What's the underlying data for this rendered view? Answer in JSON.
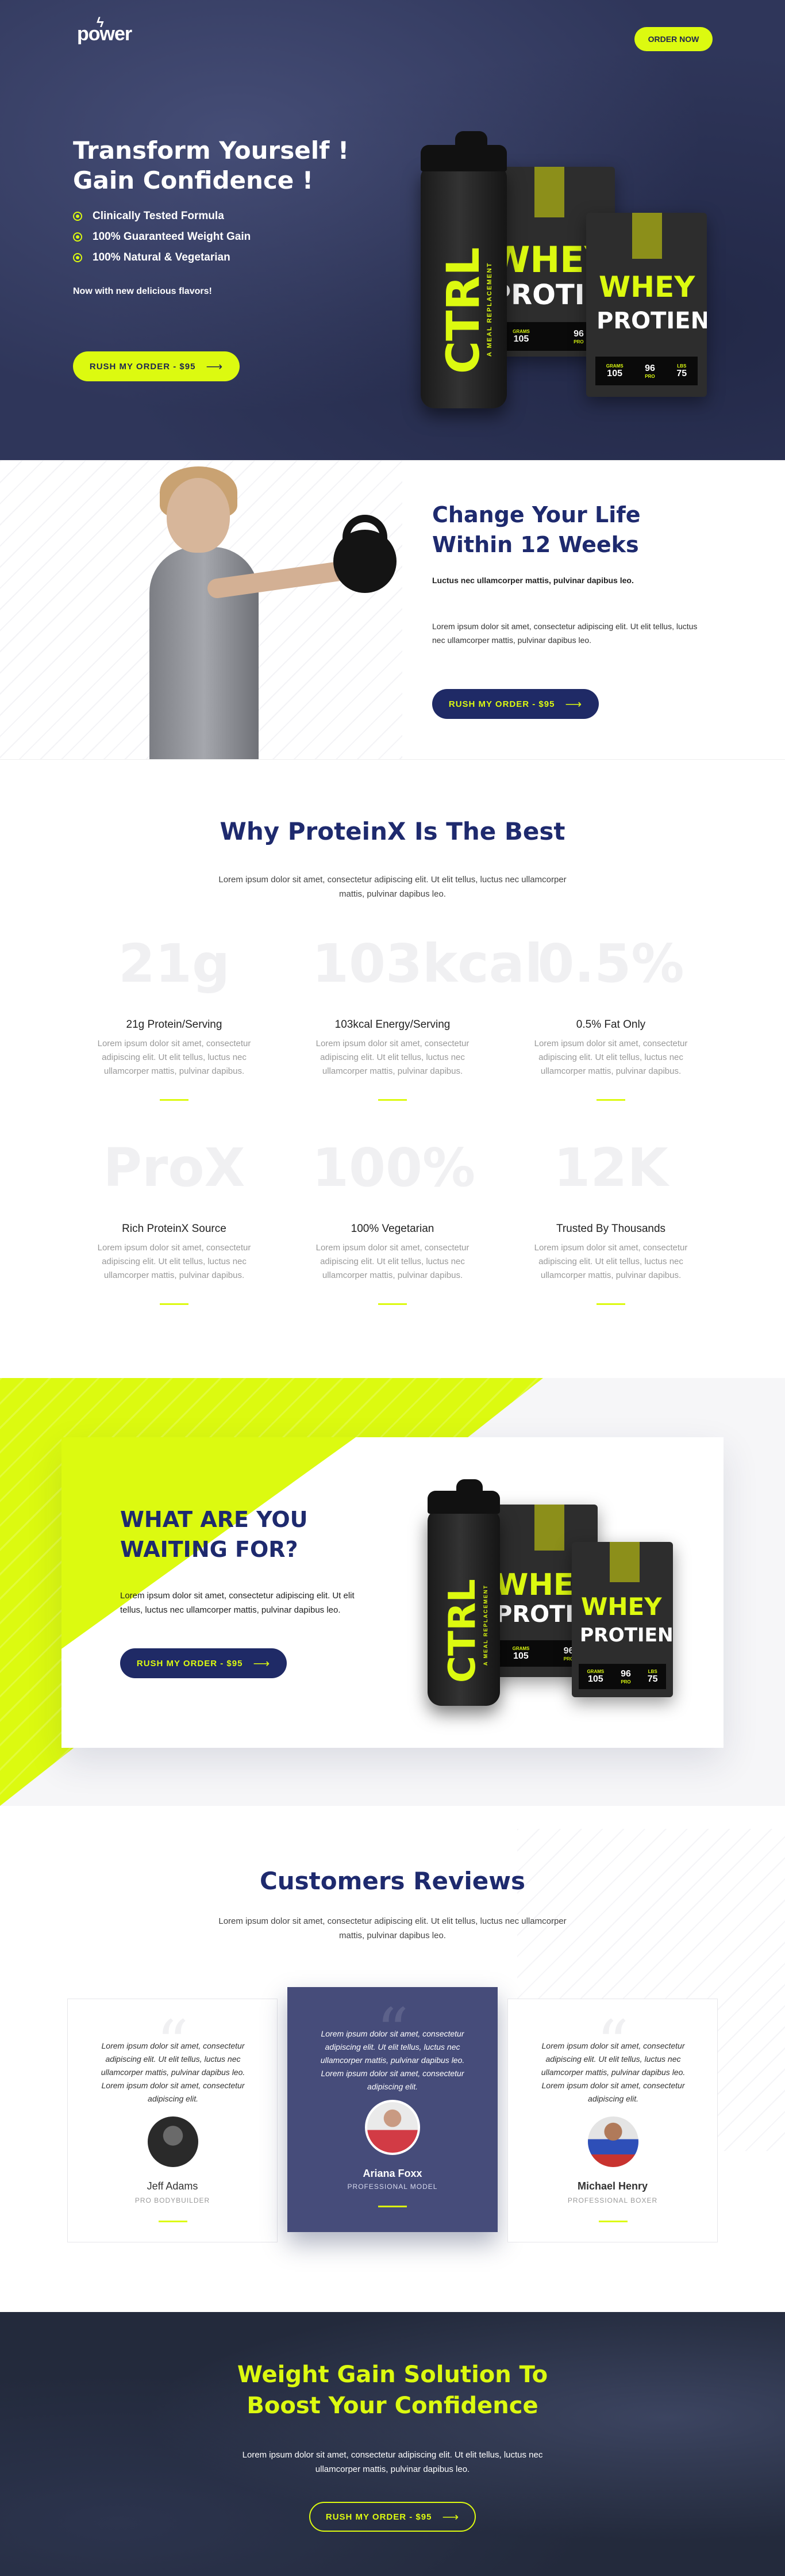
{
  "brand": {
    "logo": "power",
    "accent": "#dcfa10",
    "navy": "#1f2a66"
  },
  "header": {
    "order_button": "ORDER NOW"
  },
  "hero": {
    "title_line1": "Transform Yourself !",
    "title_line2": "Gain Confidence !",
    "checks": [
      "Clinically Tested Formula",
      "100% Guaranteed Weight Gain",
      "100% Natural & Vegetarian"
    ],
    "subtitle": "Now with new delicious flavors!",
    "cta": "RUSH MY ORDER - $95"
  },
  "product": {
    "shaker_brand": "CTRL",
    "shaker_sub": "A MEAL REPLACEMENT",
    "bag_line1": "WHEY",
    "bag_line2": "PROTIEN",
    "bag_label_back_1": "GRAMS",
    "bag_value_back_1": "105",
    "bag_value_back_2": "96",
    "bag_label_back_2": "PRO",
    "bag_label_front_1": "GRAMS",
    "bag_value_front_1": "105",
    "bag_value_front_2": "96",
    "bag_label_front_2": "PRO",
    "bag_label_front_3": "LBS",
    "bag_value_front_3": "75"
  },
  "change": {
    "title_line1": "Change Your Life",
    "title_line2": "Within 12 Weeks",
    "lead": "Luctus nec ullamcorper mattis, pulvinar dapibus leo.",
    "body": "Lorem ipsum dolor sit amet, consectetur adipiscing elit. Ut elit tellus, luctus nec ullamcorper mattis, pulvinar dapibus leo.",
    "cta": "RUSH MY ORDER - $95"
  },
  "why": {
    "title": "Why ProteinX Is The Best",
    "intro": "Lorem ipsum dolor sit amet, consectetur adipiscing elit. Ut elit tellus, luctus nec ullamcorper mattis, pulvinar dapibus leo.",
    "features": [
      {
        "num": "21g",
        "title": "21g Protein/Serving",
        "text": "Lorem ipsum dolor sit amet, consectetur adipiscing elit. Ut elit tellus, luctus nec ullamcorper mattis, pulvinar dapibus."
      },
      {
        "num": "103kcal",
        "title": "103kcal Energy/Serving",
        "text": "Lorem ipsum dolor sit amet, consectetur adipiscing elit. Ut elit tellus, luctus nec ullamcorper mattis, pulvinar dapibus."
      },
      {
        "num": "0.5%",
        "title": "0.5% Fat Only",
        "text": "Lorem ipsum dolor sit amet, consectetur adipiscing elit. Ut elit tellus, luctus nec ullamcorper mattis, pulvinar dapibus."
      },
      {
        "num": "ProX",
        "title": "Rich ProteinX Source",
        "text": "Lorem ipsum dolor sit amet, consectetur adipiscing elit. Ut elit tellus, luctus nec ullamcorper mattis, pulvinar dapibus."
      },
      {
        "num": "100%",
        "title": "100% Vegetarian",
        "text": "Lorem ipsum dolor sit amet, consectetur adipiscing elit. Ut elit tellus, luctus nec ullamcorper mattis, pulvinar dapibus."
      },
      {
        "num": "12K",
        "title": "Trusted By Thousands",
        "text": "Lorem ipsum dolor sit amet, consectetur adipiscing elit. Ut elit tellus, luctus nec ullamcorper mattis, pulvinar dapibus."
      }
    ]
  },
  "waiting": {
    "title_line1": "WHAT ARE YOU",
    "title_line2": "WAITING FOR?",
    "body": "Lorem ipsum dolor sit amet, consectetur adipiscing elit. Ut elit tellus, luctus nec ullamcorper mattis, pulvinar dapibus leo.",
    "cta": "RUSH MY ORDER - $95"
  },
  "reviews": {
    "title": "Customers Reviews",
    "intro": "Lorem ipsum dolor sit amet, consectetur adipiscing elit. Ut elit tellus, luctus nec ullamcorper mattis, pulvinar dapibus leo.",
    "items": [
      {
        "text": "Lorem ipsum dolor sit amet, consectetur adipiscing elit. Ut elit tellus, luctus nec ullamcorper mattis, pulvinar dapibus leo. Lorem ipsum dolor sit amet, consectetur adipiscing elit.",
        "name": "Jeff Adams",
        "role": "PRO BODYBUILDER"
      },
      {
        "text": "Lorem ipsum dolor sit amet, consectetur adipiscing elit. Ut elit tellus, luctus nec ullamcorper mattis, pulvinar dapibus leo. Lorem ipsum dolor sit amet, consectetur adipiscing elit.",
        "name": "Ariana Foxx",
        "role": "PROFESSIONAL MODEL"
      },
      {
        "text": "Lorem ipsum dolor sit amet, consectetur adipiscing elit. Ut elit tellus, luctus nec ullamcorper mattis, pulvinar dapibus leo. Lorem ipsum dolor sit amet, consectetur adipiscing elit.",
        "name": "Michael Henry",
        "role": "PROFESSIONAL BOXER"
      }
    ]
  },
  "cta": {
    "title_line1": "Weight Gain Solution To",
    "title_line2": "Boost Your Confidence",
    "body": "Lorem ipsum dolor sit amet, consectetur adipiscing elit. Ut elit tellus, luctus nec ullamcorper mattis, pulvinar dapibus leo.",
    "button": "RUSH MY ORDER - $95"
  }
}
